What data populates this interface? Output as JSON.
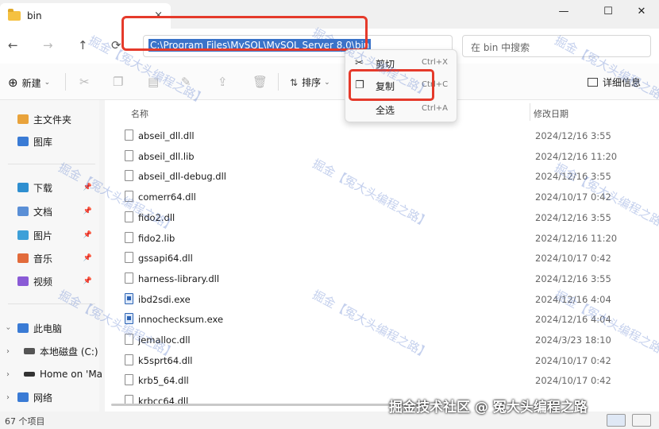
{
  "tab": {
    "title": "bin",
    "close": "×"
  },
  "window_controls": {
    "minimize": "—",
    "maximize": "☐",
    "close": "✕"
  },
  "nav": {
    "back": "←",
    "forward": "→",
    "up": "↑",
    "refresh": "⟳"
  },
  "address": {
    "path": "C:\\Program Files\\MySQL\\MySQL Server 8.0\\bin"
  },
  "search": {
    "placeholder": "在 bin 中搜索"
  },
  "toolbar": {
    "new_label": "新建",
    "sort_label": "排序",
    "details_label": "详细信息"
  },
  "sidebar": {
    "items": [
      {
        "label": "主文件夹",
        "color": "#e9a33b"
      },
      {
        "label": "图库",
        "color": "#3a7bd5"
      },
      {
        "label": "下载",
        "color": "#2f8fd0"
      },
      {
        "label": "文档",
        "color": "#5a8fd6"
      },
      {
        "label": "图片",
        "color": "#3ea0d8"
      },
      {
        "label": "音乐",
        "color": "#e26b3b"
      },
      {
        "label": "视频",
        "color": "#8a5bd6"
      },
      {
        "label": "此电脑",
        "color": "#3a7bd5"
      },
      {
        "label": "本地磁盘 (C:)",
        "color": "#555555"
      },
      {
        "label": "Home on 'Ma",
        "color": "#333333"
      },
      {
        "label": "网络",
        "color": "#3a7bd5"
      }
    ]
  },
  "columns": {
    "name": "名称",
    "modified": "修改日期"
  },
  "files": [
    {
      "name": "abseil_dll.dll",
      "date": "2024/12/16 3:55",
      "type": "dll"
    },
    {
      "name": "abseil_dll.lib",
      "date": "2024/12/16 11:20",
      "type": "lib"
    },
    {
      "name": "abseil_dll-debug.dll",
      "date": "2024/12/16 3:55",
      "type": "dll"
    },
    {
      "name": "comerr64.dll",
      "date": "2024/10/17 0:42",
      "type": "dll"
    },
    {
      "name": "fido2.dll",
      "date": "2024/12/16 3:55",
      "type": "dll"
    },
    {
      "name": "fido2.lib",
      "date": "2024/12/16 11:20",
      "type": "lib"
    },
    {
      "name": "gssapi64.dll",
      "date": "2024/10/17 0:42",
      "type": "dll"
    },
    {
      "name": "harness-library.dll",
      "date": "2024/12/16 3:55",
      "type": "dll"
    },
    {
      "name": "ibd2sdi.exe",
      "date": "2024/12/16 4:04",
      "type": "exe"
    },
    {
      "name": "innochecksum.exe",
      "date": "2024/12/16 4:04",
      "type": "exe"
    },
    {
      "name": "jemalloc.dll",
      "date": "2024/3/23 18:10",
      "type": "dll"
    },
    {
      "name": "k5sprt64.dll",
      "date": "2024/10/17 0:42",
      "type": "dll"
    },
    {
      "name": "krb5_64.dll",
      "date": "2024/10/17 0:42",
      "type": "dll"
    },
    {
      "name": "krbcc64.dll",
      "date": "",
      "type": "dll"
    }
  ],
  "context_menu": [
    {
      "label": "剪切",
      "shortcut": "Ctrl+X",
      "icon": "cut-icon"
    },
    {
      "label": "复制",
      "shortcut": "Ctrl+C",
      "icon": "copy-icon"
    },
    {
      "label": "全选",
      "shortcut": "Ctrl+A",
      "icon": ""
    }
  ],
  "status": {
    "count": "67 个项目"
  },
  "watermark": "掘金【冤大头编程之路】",
  "credit": "掘金技术社区 @ 冤大头编程之路",
  "colors": {
    "highlight_red": "#e53a2b",
    "selection_blue": "#3a73c9",
    "folder_yellow": "#f5c141"
  }
}
